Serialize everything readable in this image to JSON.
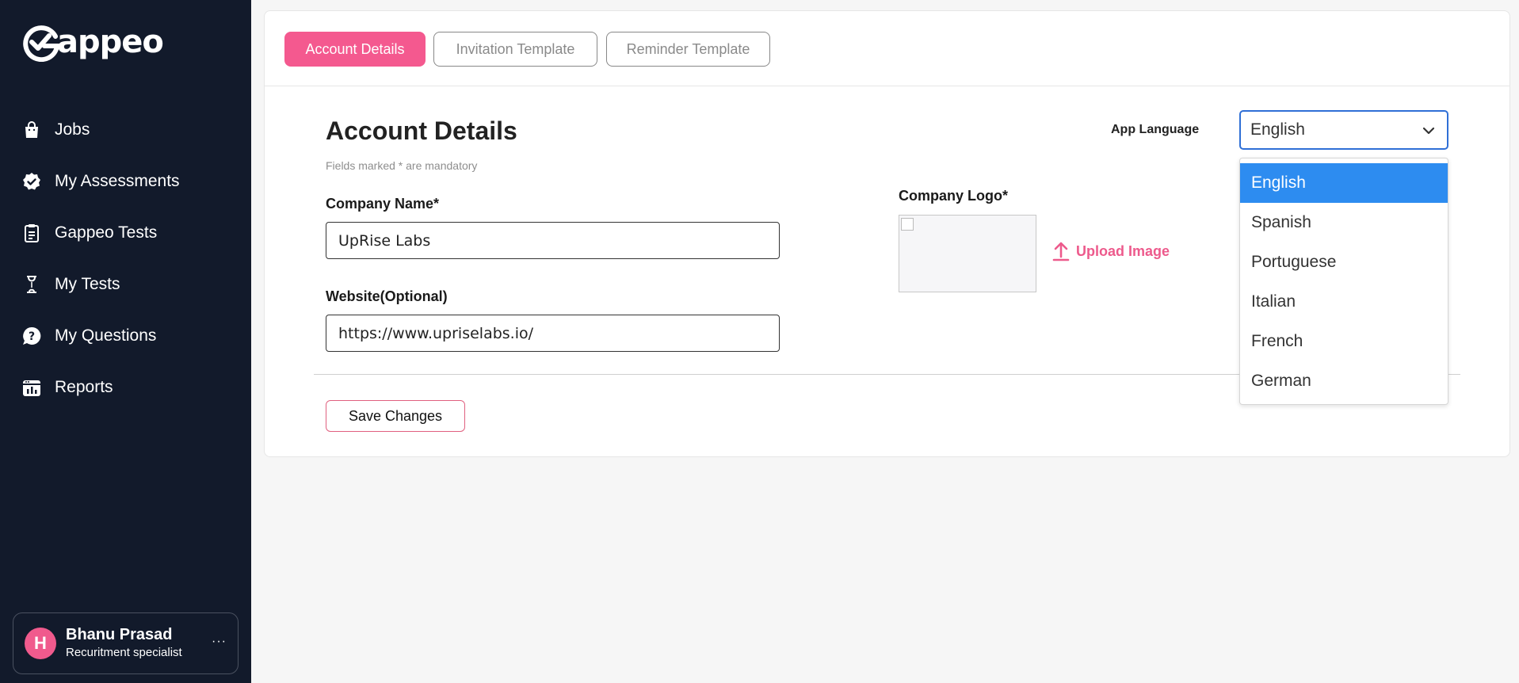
{
  "brand": {
    "name": "Gappeo",
    "logo_text": "appeo",
    "accent": "#f4598f",
    "sidebar_bg": "#121a2b"
  },
  "sidebar": {
    "items": [
      {
        "label": "Jobs",
        "icon": "shopping-bag-icon"
      },
      {
        "label": "My Assessments",
        "icon": "badge-check-icon"
      },
      {
        "label": "Gappeo Tests",
        "icon": "clipboard-icon"
      },
      {
        "label": "My Tests",
        "icon": "hourglass-icon"
      },
      {
        "label": "My Questions",
        "icon": "question-bubble-icon"
      },
      {
        "label": "Reports",
        "icon": "calendar-chart-icon"
      }
    ]
  },
  "user": {
    "initial": "H",
    "name": "Bhanu Prasad",
    "role": "Recuritment specialist",
    "more": "···"
  },
  "tabs": [
    {
      "label": "Account Details",
      "active": true
    },
    {
      "label": "Invitation Template",
      "active": false
    },
    {
      "label": "Reminder Template",
      "active": false
    }
  ],
  "form": {
    "title": "Account Details",
    "mandatory_note": "Fields marked * are mandatory",
    "company_name": {
      "label": "Company Name*",
      "value": "UpRise Labs"
    },
    "website": {
      "label": "Website(Optional)",
      "value": "https://www.upriselabs.io/"
    },
    "company_logo": {
      "label": "Company Logo*",
      "upload_label": "Upload Image"
    },
    "app_language": {
      "label": "App Language",
      "selected": "English",
      "options": [
        "English",
        "Spanish",
        "Portuguese",
        "Italian",
        "French",
        "German"
      ],
      "highlight_color": "#2d8cf0"
    },
    "save_label": "Save Changes"
  }
}
